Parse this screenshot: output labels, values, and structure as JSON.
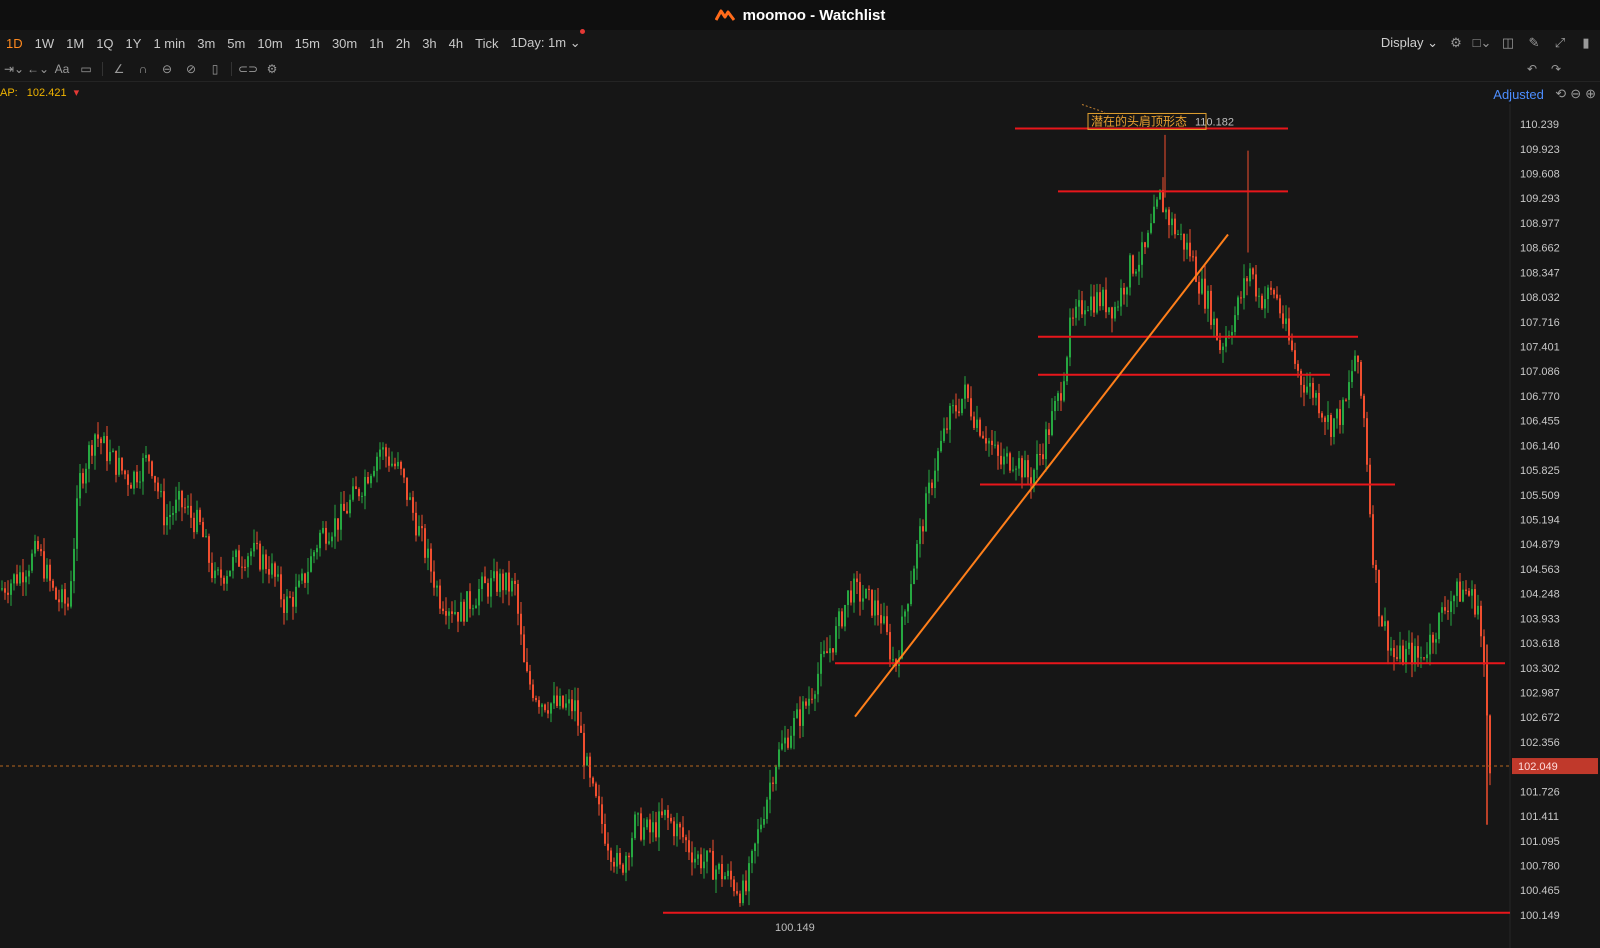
{
  "window": {
    "title": "moomoo - Watchlist"
  },
  "timeframes": [
    "1D",
    "1W",
    "1M",
    "1Q",
    "1Y",
    "1 min",
    "3m",
    "5m",
    "10m",
    "15m",
    "30m",
    "1h",
    "2h",
    "3h",
    "4h",
    "Tick",
    "1Day: 1m"
  ],
  "active_timeframe": "1D",
  "toolbar": {
    "display_label": "Display"
  },
  "indicator": {
    "label": "AP:",
    "value": "102.421"
  },
  "right_panel": {
    "adjusted_label": "Adjusted"
  },
  "colors": {
    "up": "#26a841",
    "down": "#f04e2f",
    "hline": "#e8161b",
    "trend": "#ff7f1a",
    "accent": "#ff8a1f",
    "price_tag": "#c0392b"
  },
  "chart_data": {
    "type": "candlestick",
    "ylim": [
      100.0,
      110.4
    ],
    "ticks": [
      "110.239",
      "109.923",
      "109.608",
      "109.293",
      "108.977",
      "108.662",
      "108.347",
      "108.032",
      "107.716",
      "107.401",
      "107.086",
      "106.770",
      "106.455",
      "106.140",
      "105.825",
      "105.509",
      "105.194",
      "104.879",
      "104.563",
      "104.248",
      "103.933",
      "103.618",
      "103.302",
      "102.987",
      "102.672",
      "102.356",
      "102.049",
      "101.726",
      "101.411",
      "101.095",
      "100.780",
      "100.465",
      "100.149"
    ],
    "current_price": "102.049",
    "annotation": {
      "text": "潜在的头肩顶形态",
      "high_label": "110.182",
      "low_label": "100.149"
    },
    "close_path": [
      [
        0,
        104.3
      ],
      [
        20,
        104.5
      ],
      [
        38,
        104.8
      ],
      [
        55,
        104.2
      ],
      [
        68,
        104.1
      ],
      [
        80,
        105.7
      ],
      [
        95,
        106.3
      ],
      [
        110,
        106.0
      ],
      [
        130,
        105.7
      ],
      [
        150,
        106.0
      ],
      [
        165,
        105.2
      ],
      [
        180,
        105.4
      ],
      [
        200,
        105.1
      ],
      [
        215,
        104.4
      ],
      [
        230,
        104.6
      ],
      [
        250,
        104.8
      ],
      [
        270,
        104.6
      ],
      [
        285,
        104.1
      ],
      [
        300,
        104.3
      ],
      [
        320,
        105.0
      ],
      [
        340,
        105.2
      ],
      [
        360,
        105.6
      ],
      [
        380,
        106.1
      ],
      [
        400,
        105.8
      ],
      [
        420,
        105.0
      ],
      [
        440,
        104.2
      ],
      [
        460,
        104.0
      ],
      [
        480,
        104.3
      ],
      [
        500,
        104.4
      ],
      [
        515,
        104.3
      ],
      [
        525,
        103.2
      ],
      [
        540,
        102.9
      ],
      [
        560,
        102.8
      ],
      [
        575,
        102.8
      ],
      [
        590,
        101.8
      ],
      [
        605,
        101.2
      ],
      [
        620,
        100.7
      ],
      [
        635,
        101.3
      ],
      [
        650,
        101.2
      ],
      [
        665,
        101.4
      ],
      [
        680,
        101.2
      ],
      [
        695,
        100.9
      ],
      [
        710,
        100.8
      ],
      [
        730,
        100.6
      ],
      [
        745,
        100.4
      ],
      [
        760,
        101.3
      ],
      [
        775,
        102.1
      ],
      [
        790,
        102.5
      ],
      [
        805,
        102.8
      ],
      [
        820,
        103.3
      ],
      [
        835,
        103.7
      ],
      [
        850,
        104.3
      ],
      [
        865,
        104.2
      ],
      [
        880,
        104.0
      ],
      [
        895,
        103.3
      ],
      [
        910,
        104.4
      ],
      [
        920,
        105.0
      ],
      [
        935,
        105.9
      ],
      [
        950,
        106.5
      ],
      [
        965,
        106.8
      ],
      [
        975,
        106.5
      ],
      [
        985,
        106.3
      ],
      [
        1000,
        105.9
      ],
      [
        1015,
        106.0
      ],
      [
        1030,
        105.7
      ],
      [
        1045,
        106.2
      ],
      [
        1060,
        106.8
      ],
      [
        1070,
        107.6
      ],
      [
        1085,
        108.0
      ],
      [
        1100,
        108.0
      ],
      [
        1115,
        107.9
      ],
      [
        1130,
        108.4
      ],
      [
        1145,
        108.6
      ],
      [
        1160,
        109.3
      ],
      [
        1170,
        109.0
      ],
      [
        1180,
        108.8
      ],
      [
        1190,
        108.6
      ],
      [
        1200,
        108.2
      ],
      [
        1210,
        107.9
      ],
      [
        1220,
        107.4
      ],
      [
        1235,
        107.8
      ],
      [
        1250,
        108.4
      ],
      [
        1260,
        108.0
      ],
      [
        1275,
        108.1
      ],
      [
        1290,
        107.4
      ],
      [
        1300,
        107.0
      ],
      [
        1315,
        106.8
      ],
      [
        1330,
        106.4
      ],
      [
        1345,
        106.6
      ],
      [
        1355,
        107.3
      ],
      [
        1365,
        106.4
      ],
      [
        1372,
        104.9
      ],
      [
        1380,
        104.0
      ],
      [
        1395,
        103.4
      ],
      [
        1410,
        103.5
      ],
      [
        1420,
        103.4
      ],
      [
        1435,
        103.8
      ],
      [
        1450,
        104.2
      ],
      [
        1465,
        104.3
      ],
      [
        1478,
        104.1
      ],
      [
        1485,
        103.1
      ],
      [
        1490,
        102.1
      ]
    ],
    "hlines": [
      {
        "x1": 1015,
        "x2": 1288,
        "y": 110.182
      },
      {
        "x1": 1058,
        "x2": 1288,
        "y": 109.38
      },
      {
        "x1": 1038,
        "x2": 1358,
        "y": 107.525
      },
      {
        "x1": 1038,
        "x2": 1330,
        "y": 107.04
      },
      {
        "x1": 980,
        "x2": 1395,
        "y": 105.64
      },
      {
        "x1": 835,
        "x2": 1505,
        "y": 103.36
      },
      {
        "x1": 663,
        "x2": 1510,
        "y": 100.178
      }
    ],
    "trendline": {
      "x1": 855,
      "y1": 102.68,
      "x2": 1228,
      "y2": 108.83
    }
  }
}
